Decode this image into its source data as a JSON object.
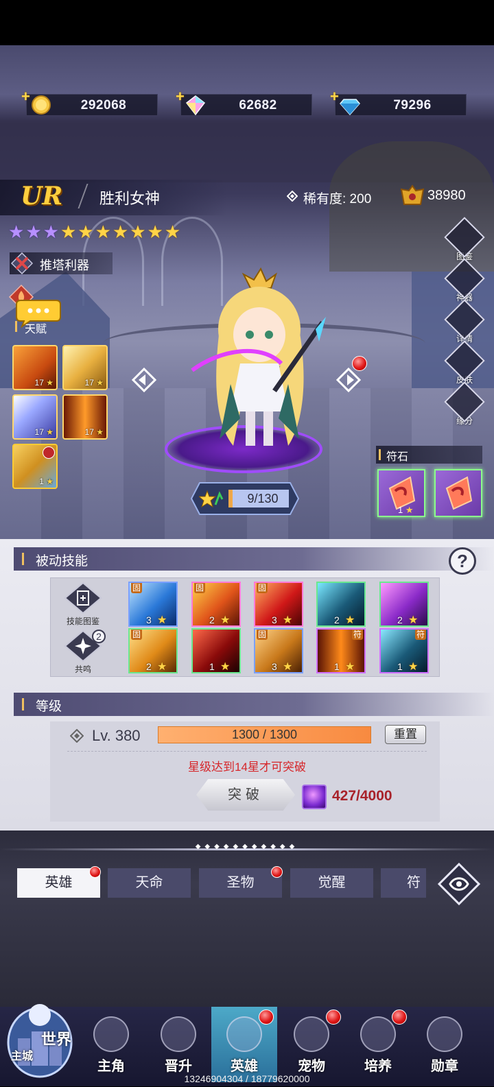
{
  "currency": {
    "gold": "292068",
    "gem_rainbow": "62682",
    "gem_blue": "79296"
  },
  "hero": {
    "rarity": "UR",
    "name": "胜利女神",
    "rarity_label": "稀有度: 200",
    "power": "38980",
    "stars_purple": 3,
    "stars_gold": 7,
    "role": "推塔利器"
  },
  "talents": {
    "label": "天赋",
    "levels": [
      "17",
      "17",
      "17",
      "17",
      "1"
    ]
  },
  "side_buttons": [
    "图鉴",
    "神器",
    "详情",
    "皮肤",
    "缘分"
  ],
  "rune": {
    "title": "符石",
    "levels": [
      "1",
      "1"
    ]
  },
  "hero_level_pill": "9/130",
  "passive": {
    "title": "被动技能",
    "help": "?",
    "left_buttons": [
      "技能图鉴",
      "共鸣"
    ],
    "resonance_badge": "2",
    "fixed_tag": "固",
    "rune_tag": "符",
    "row1_levels": [
      "3",
      "2",
      "3",
      "2",
      "2"
    ],
    "row2_levels": [
      "2",
      "1",
      "3",
      "1",
      "1"
    ]
  },
  "level": {
    "title": "等级",
    "lv_text": "Lv. 380",
    "exp_text": "1300 / 1300",
    "exp_progress": 1.0,
    "reset_label": "重置",
    "warning": "星级达到14星才可突破",
    "break_label": "突破",
    "material": "427/4000"
  },
  "tabs": [
    "英雄",
    "天命",
    "圣物",
    "觉醒",
    "符文"
  ],
  "bottom_nav": [
    "主城",
    "主角",
    "晋升",
    "英雄",
    "宠物",
    "培养",
    "勋章"
  ],
  "world_label": "世界",
  "footer_ids": "13246904304 / 18779620000"
}
